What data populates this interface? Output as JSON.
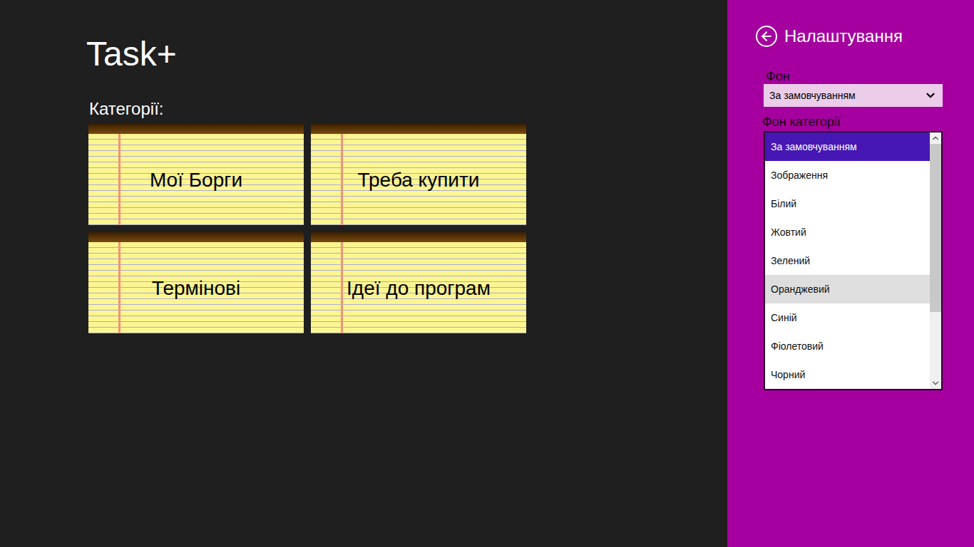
{
  "app": {
    "title": "Task+"
  },
  "categories": {
    "label": "Категорії:",
    "items": [
      {
        "name": "Мої Борги"
      },
      {
        "name": "Треба купити"
      },
      {
        "name": "Термінові"
      },
      {
        "name": "Ідеї до програм"
      }
    ]
  },
  "settings": {
    "title": "Налаштування",
    "background": {
      "label": "Фон",
      "value": "За замовчуванням"
    },
    "category_background": {
      "label": "Фон категорії",
      "expanded": true,
      "scrollbar": {
        "level": 0.72
      },
      "options": [
        {
          "label": "За замовчуванням",
          "selected": true,
          "highlighted": false
        },
        {
          "label": "Зображення",
          "selected": false,
          "highlighted": false
        },
        {
          "label": "Білий",
          "selected": false,
          "highlighted": false
        },
        {
          "label": "Жовтий",
          "selected": false,
          "highlighted": false
        },
        {
          "label": "Зелений",
          "selected": false,
          "highlighted": false
        },
        {
          "label": "Оранджевий",
          "selected": false,
          "highlighted": true
        },
        {
          "label": "Синій",
          "selected": false,
          "highlighted": false
        },
        {
          "label": "Фіолетовий",
          "selected": false,
          "highlighted": false
        },
        {
          "label": "Чорний",
          "selected": false,
          "highlighted": false
        }
      ]
    }
  }
}
